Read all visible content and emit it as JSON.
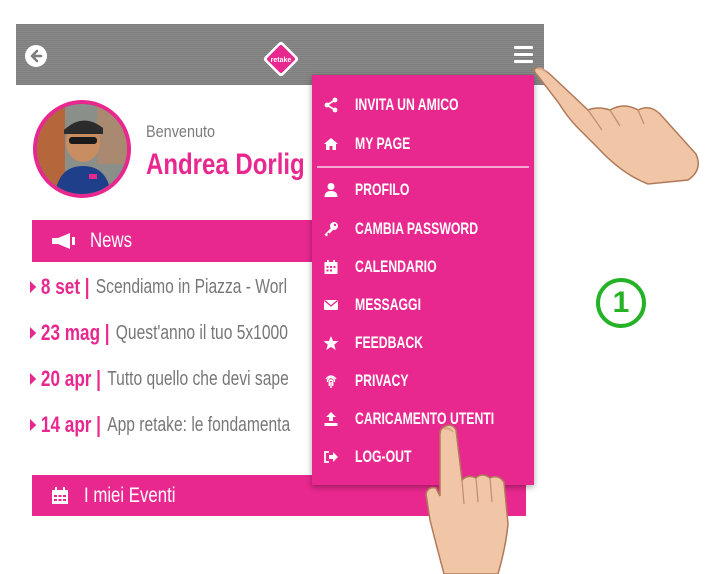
{
  "topbar": {
    "logo_text": "retake"
  },
  "profile": {
    "welcome": "Benvenuto",
    "name": "Andrea Dorlig"
  },
  "news": {
    "title": "News",
    "items": [
      {
        "date": "8 set",
        "text": "Scendiamo in Piazza - Worl"
      },
      {
        "date": "23 mag",
        "text": "Quest'anno il tuo 5x1000"
      },
      {
        "date": "20 apr",
        "text": "Tutto quello che devi sape"
      },
      {
        "date": "14 apr",
        "text": "App retake: le fondamenta"
      }
    ]
  },
  "events": {
    "title": "I miei Eventi"
  },
  "menu": {
    "items": [
      {
        "label": "INVITA UN AMICO",
        "icon": "share-icon"
      },
      {
        "label": "MY PAGE",
        "icon": "home-icon"
      },
      {
        "label": "PROFILO",
        "icon": "user-icon"
      },
      {
        "label": "CAMBIA PASSWORD",
        "icon": "key-icon"
      },
      {
        "label": "CALENDARIO",
        "icon": "calendar-icon"
      },
      {
        "label": "MESSAGGI",
        "icon": "envelope-icon"
      },
      {
        "label": "FEEDBACK",
        "icon": "star-icon"
      },
      {
        "label": "PRIVACY",
        "icon": "fingerprint-icon"
      },
      {
        "label": "CARICAMENTO UTENTI",
        "icon": "upload-icon"
      },
      {
        "label": "LOG-OUT",
        "icon": "logout-icon"
      }
    ]
  },
  "step": {
    "number": "1"
  },
  "colors": {
    "accent": "#e8288f",
    "topbar": "#858585",
    "step_green": "#26b226"
  }
}
